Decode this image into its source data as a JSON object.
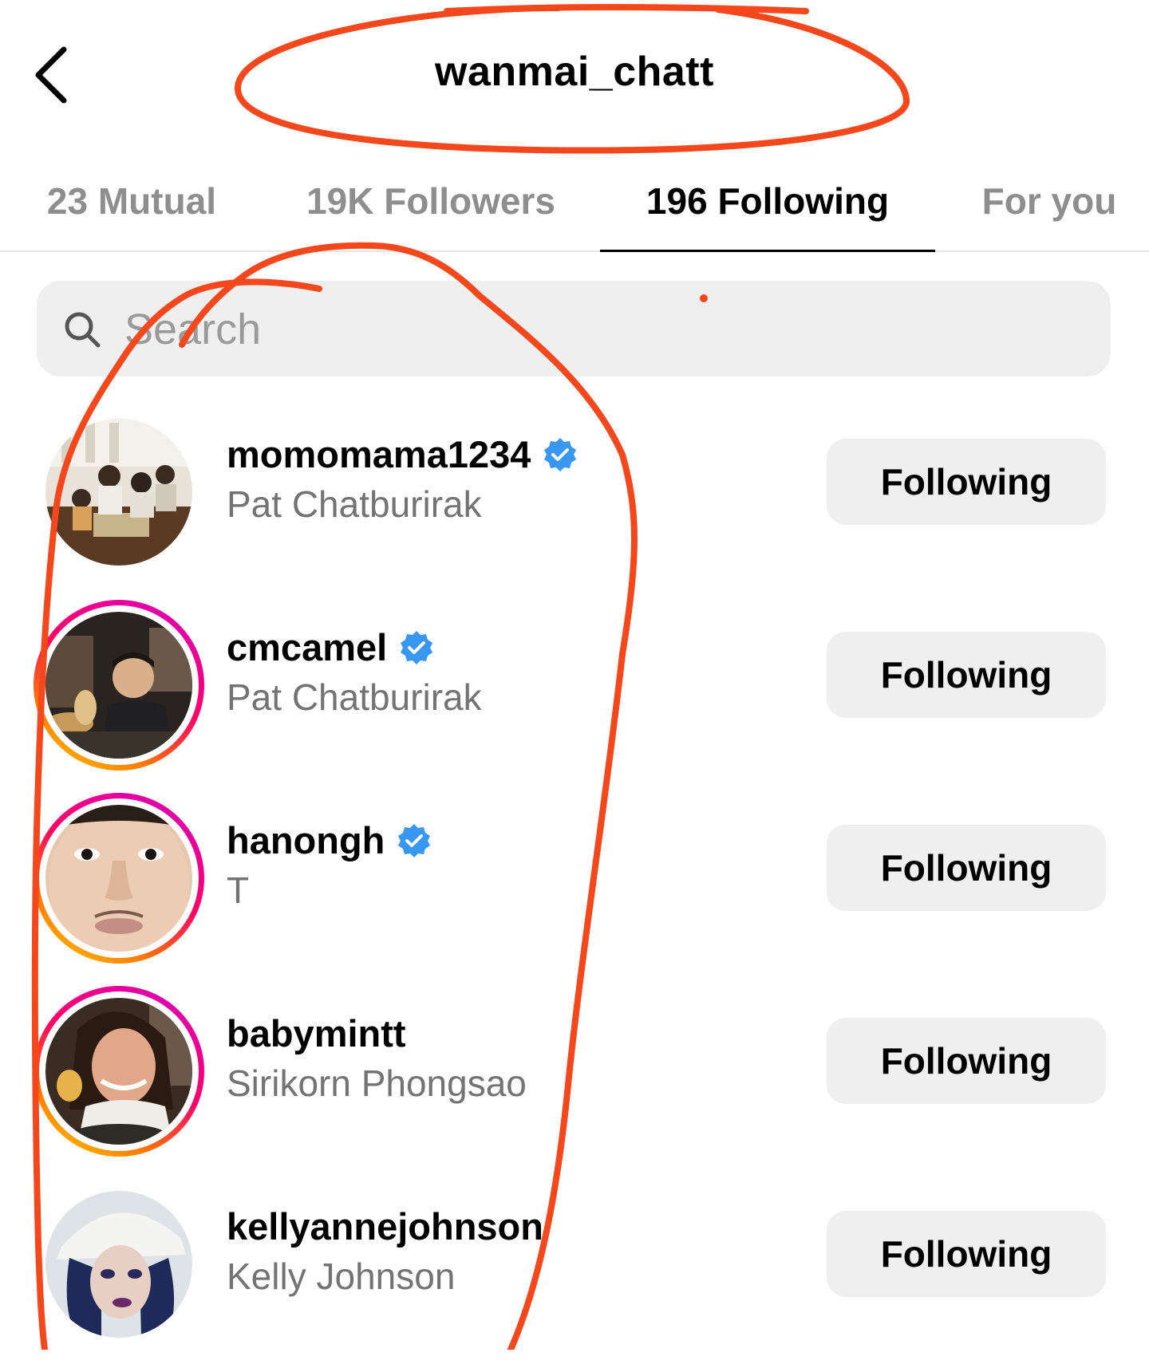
{
  "header": {
    "title": "wanmai_chatt"
  },
  "tabs": [
    {
      "label": "23 Mutual",
      "active": false
    },
    {
      "label": "19K Followers",
      "active": false
    },
    {
      "label": "196 Following",
      "active": true
    },
    {
      "label": "For you",
      "active": false
    }
  ],
  "search": {
    "placeholder": "Search",
    "value": ""
  },
  "users": [
    {
      "username": "momomama1234",
      "name": "Pat Chatburirak",
      "verified": true,
      "story_ring": false,
      "button": "Following"
    },
    {
      "username": "cmcamel",
      "name": "Pat Chatburirak",
      "verified": true,
      "story_ring": true,
      "button": "Following"
    },
    {
      "username": "hanongh",
      "name": "T",
      "verified": true,
      "story_ring": true,
      "button": "Following"
    },
    {
      "username": "babymintt",
      "name": "Sirikorn Phongsao",
      "verified": false,
      "story_ring": true,
      "button": "Following"
    },
    {
      "username": "kellyannejohnson",
      "name": "Kelly Johnson",
      "verified": false,
      "story_ring": false,
      "button": "Following"
    }
  ],
  "colors": {
    "annotation": "#f4471c",
    "verified": "#3897f0",
    "active_tab": "#000000",
    "inactive_tab": "#8e8e8e"
  }
}
